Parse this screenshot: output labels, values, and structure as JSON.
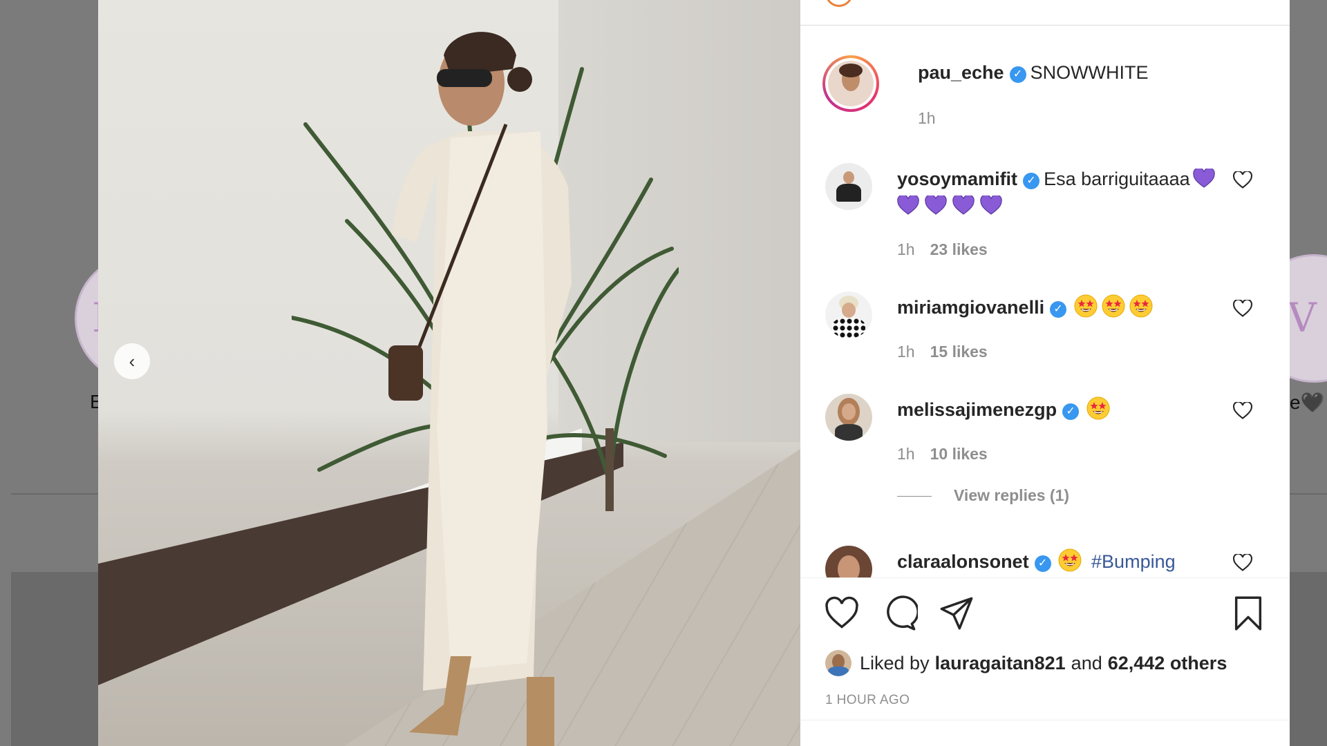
{
  "backdrop": {
    "left_story_label": "E",
    "right_story_label": "ve🖤"
  },
  "post": {
    "author": {
      "username": "pau_eche",
      "verified": true,
      "caption": "SNOWWHITE",
      "time": "1h"
    },
    "comments": [
      {
        "username": "yosoymamifit",
        "verified": true,
        "text": "Esa barriguitaaaa",
        "emoji": [
          "purple-heart",
          "purple-heart",
          "purple-heart",
          "purple-heart",
          "purple-heart"
        ],
        "time": "1h",
        "likes": "23 likes"
      },
      {
        "username": "miriamgiovanelli",
        "verified": true,
        "text": "",
        "emoji": [
          "star-struck",
          "star-struck",
          "star-struck"
        ],
        "time": "1h",
        "likes": "15 likes"
      },
      {
        "username": "melissajimenezgp",
        "verified": true,
        "text": "",
        "emoji": [
          "star-struck"
        ],
        "time": "1h",
        "likes": "10 likes",
        "view_replies": "View replies (1)"
      },
      {
        "username": "claraalonsonet",
        "verified": true,
        "text": "",
        "emoji": [
          "star-struck"
        ],
        "hashtag": "#Bumping"
      }
    ],
    "actions": {
      "like_icon": "heart-icon",
      "comment_icon": "comment-icon",
      "share_icon": "send-icon",
      "save_icon": "bookmark-icon"
    },
    "liked_by": {
      "prefix": "Liked by",
      "user": "lauragaitan821",
      "conjunction": "and",
      "others": "62,442 others"
    },
    "timestamp": "1 HOUR AGO"
  },
  "colors": {
    "verified_blue": "#3897f0",
    "text_primary": "#262626",
    "text_secondary": "#8e8e8e",
    "purple_heart": "#8a5bd6",
    "hashtag": "#385898"
  }
}
